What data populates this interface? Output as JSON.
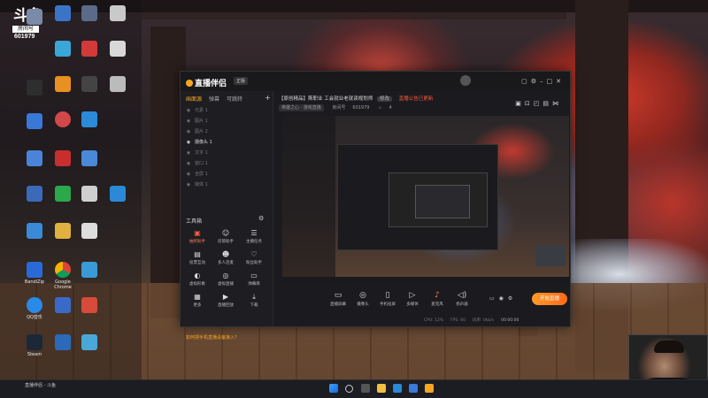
{
  "stream_room": {
    "logo_text": "斗鱼",
    "room_label": "房间号",
    "room_number": "601979"
  },
  "desktop_icons": [
    {
      "label": "斗鱼"
    },
    {
      "label": "此电脑"
    },
    {
      "label": "回收站"
    },
    {
      "label": "QQ"
    },
    {
      "label": "微信"
    },
    {
      "label": "BandiZip"
    },
    {
      "label": "Google Chrome"
    },
    {
      "label": "Steam"
    },
    {
      "label": "QQ音乐"
    },
    {
      "label": "迅雷"
    }
  ],
  "app": {
    "name": "直播伴侣",
    "version_tag": "正版",
    "sidebar": {
      "tabs": [
        "画面源",
        "弹幕",
        "可跳转"
      ],
      "sources": [
        {
          "label": "元素 1",
          "active": false
        },
        {
          "label": "图片 1",
          "active": false
        },
        {
          "label": "图片 2",
          "active": false
        },
        {
          "label": "摄像头 1",
          "active": true
        },
        {
          "label": "文字 1",
          "active": false
        },
        {
          "label": "窗口 1",
          "active": false
        },
        {
          "label": "全屏 1",
          "active": false
        },
        {
          "label": "媒体 1",
          "active": false
        }
      ],
      "toolbox_label": "工具箱",
      "tools": [
        {
          "label": "抽奖助手",
          "icon": "gift-icon"
        },
        {
          "label": "房管助手",
          "icon": "user-icon"
        },
        {
          "label": "主播任务",
          "icon": "task-icon"
        },
        {
          "label": "投票互动",
          "icon": "vote-icon"
        },
        {
          "label": "多人连麦",
          "icon": "people-icon"
        },
        {
          "label": "粉丝助手",
          "icon": "fans-icon"
        },
        {
          "label": "虚拟形象",
          "icon": "avatar-icon"
        },
        {
          "label": "虚拟直播",
          "icon": "virtual-icon"
        },
        {
          "label": "弹幕库",
          "icon": "danmaku-icon"
        },
        {
          "label": "更多",
          "icon": "more-icon"
        },
        {
          "label": "直播回放",
          "icon": "replay-icon"
        },
        {
          "label": "下载",
          "icon": "download-icon"
        }
      ],
      "hint": "如何把手机直播设备接入？"
    },
    "header": {
      "room_title": "【原创精品】斯职业 工会就业老就读规划师",
      "edit_label": "修改",
      "notice": "直播公告已更新",
      "category": "英雄之心 · 游戏直播",
      "room_id_label": "房间号",
      "room_id": "601979",
      "fans": "4"
    },
    "controls": [
      {
        "label": "直播屏幕",
        "icon": "screen-icon"
      },
      {
        "label": "摄像头",
        "icon": "camera-icon"
      },
      {
        "label": "手机投屏",
        "icon": "phone-icon"
      },
      {
        "label": "多媒体",
        "icon": "media-icon"
      },
      {
        "label": "麦克风",
        "icon": "mic-icon"
      },
      {
        "label": "扬声器",
        "icon": "speaker-icon"
      }
    ],
    "start_button": "开始直播",
    "status": {
      "cpu": "CPU: 12%",
      "fps": "FPS: 60",
      "bitrate": "码率: 0kb/s",
      "time": "00:00:00"
    }
  },
  "taskbar": {
    "window_label": "直播伴侣 - 斗鱼",
    "icons": [
      "windows-icon",
      "search-icon",
      "taskview-icon",
      "explorer-icon",
      "browser-icon",
      "store-icon",
      "app-icon"
    ]
  }
}
